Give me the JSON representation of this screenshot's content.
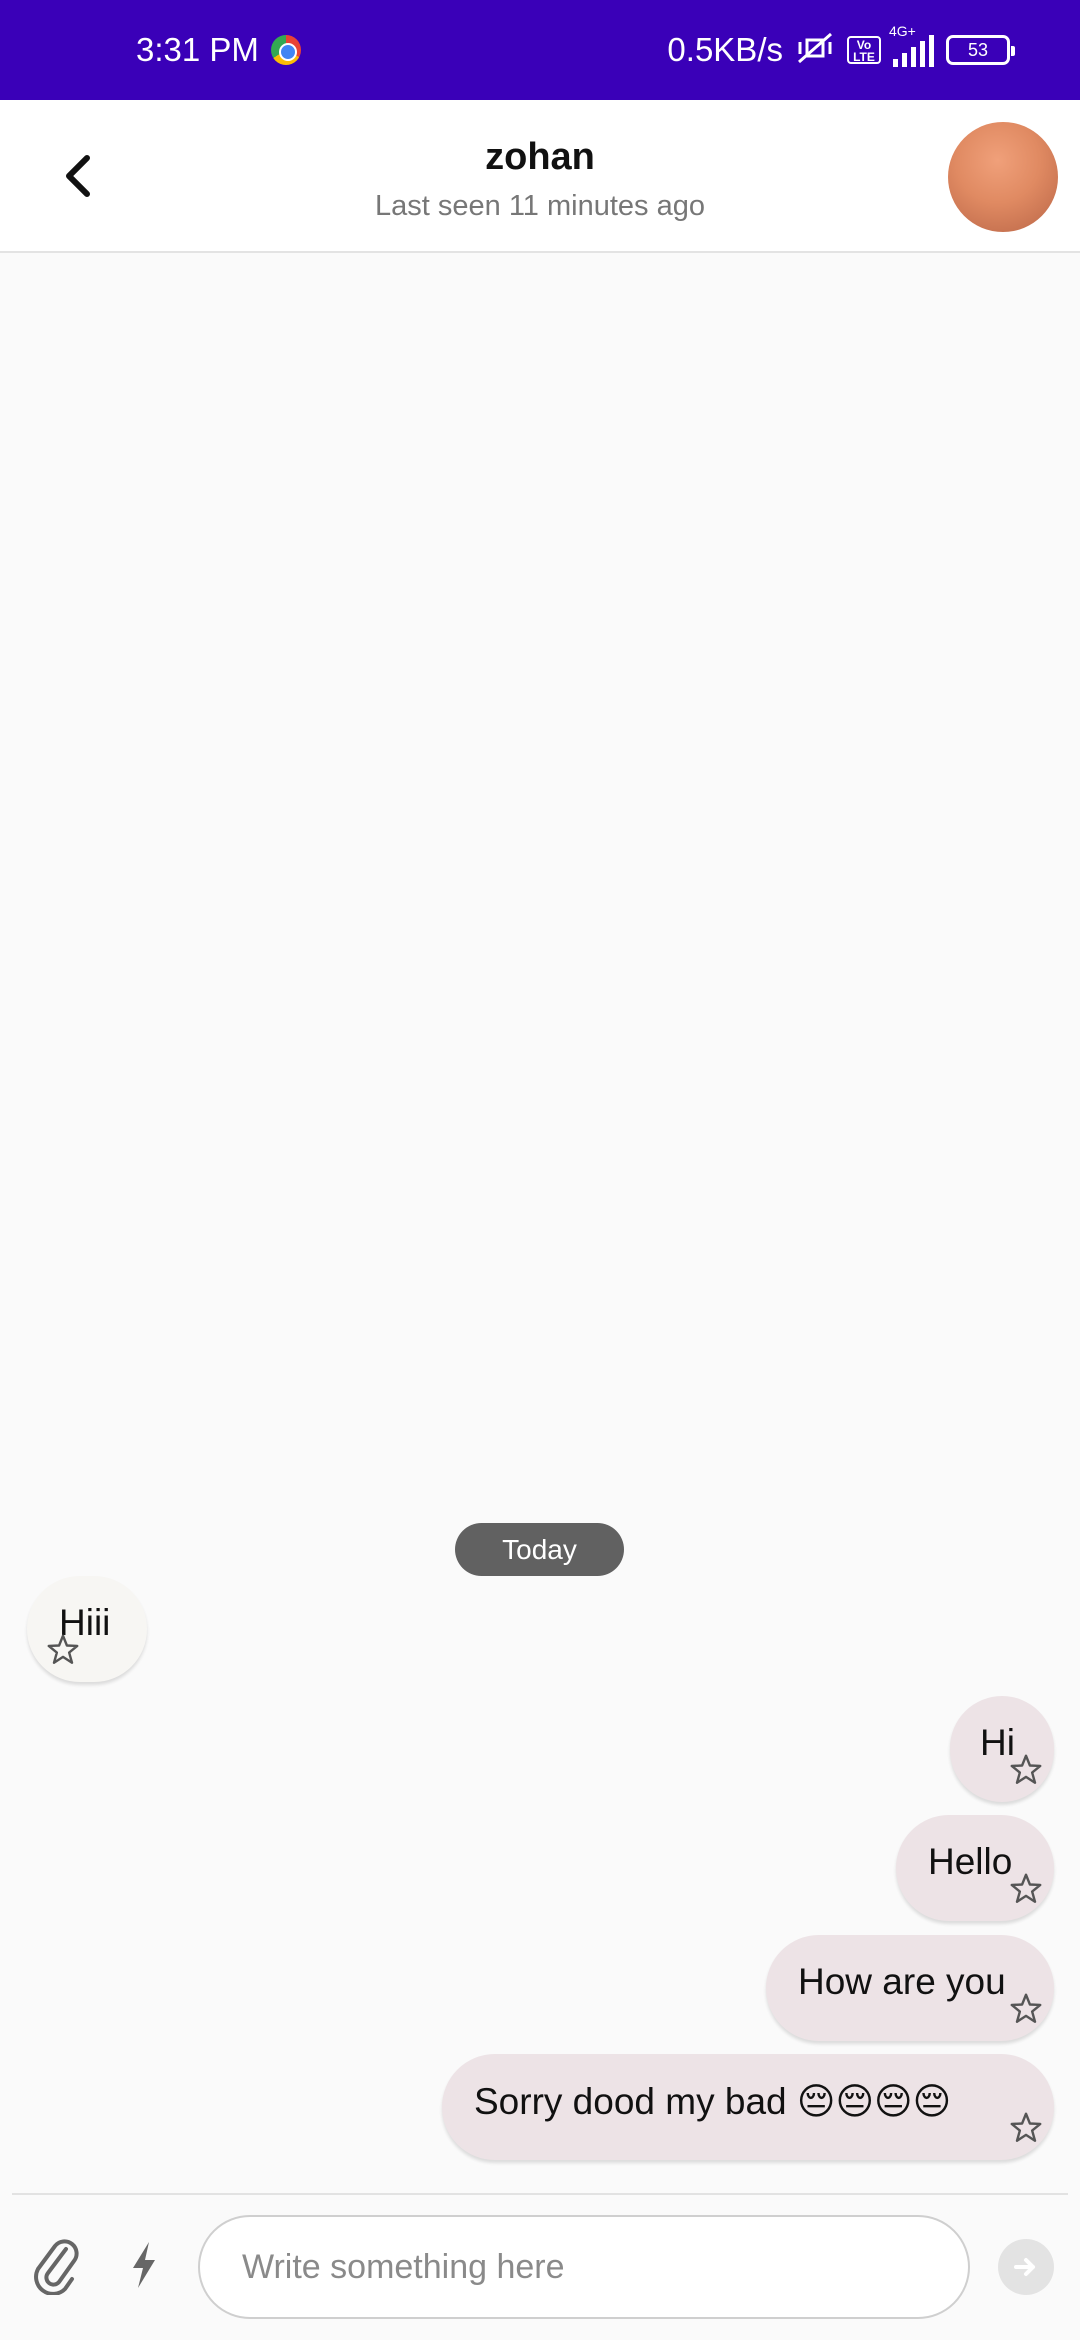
{
  "status_bar": {
    "time": "3:31 PM",
    "network_speed": "0.5KB/s",
    "network_type": "4G+",
    "volte": "Vo LTE",
    "battery": "53",
    "background_color": "#3a00b8"
  },
  "header": {
    "contact_name": "zohan",
    "last_seen": "Last seen 11 minutes ago",
    "back_icon": "chevron-left-icon"
  },
  "chat": {
    "date_separator": "Today",
    "messages": [
      {
        "direction": "incoming",
        "text": "Hiii",
        "starred": false
      },
      {
        "direction": "outgoing",
        "text": "Hi",
        "starred": false
      },
      {
        "direction": "outgoing",
        "text": "Hello",
        "starred": false
      },
      {
        "direction": "outgoing",
        "text": "How are you",
        "starred": false
      },
      {
        "direction": "outgoing",
        "text": "Sorry dood my bad 😔😔😔😔",
        "starred": false
      }
    ],
    "incoming_bubble_color": "#f7f6f3",
    "outgoing_bubble_color": "#ede3e6"
  },
  "composer": {
    "placeholder": "Write something here",
    "value": "",
    "attach_icon": "paperclip-icon",
    "quick_reply_icon": "lightning-bolt-icon",
    "send_icon": "send-arrow-icon"
  }
}
